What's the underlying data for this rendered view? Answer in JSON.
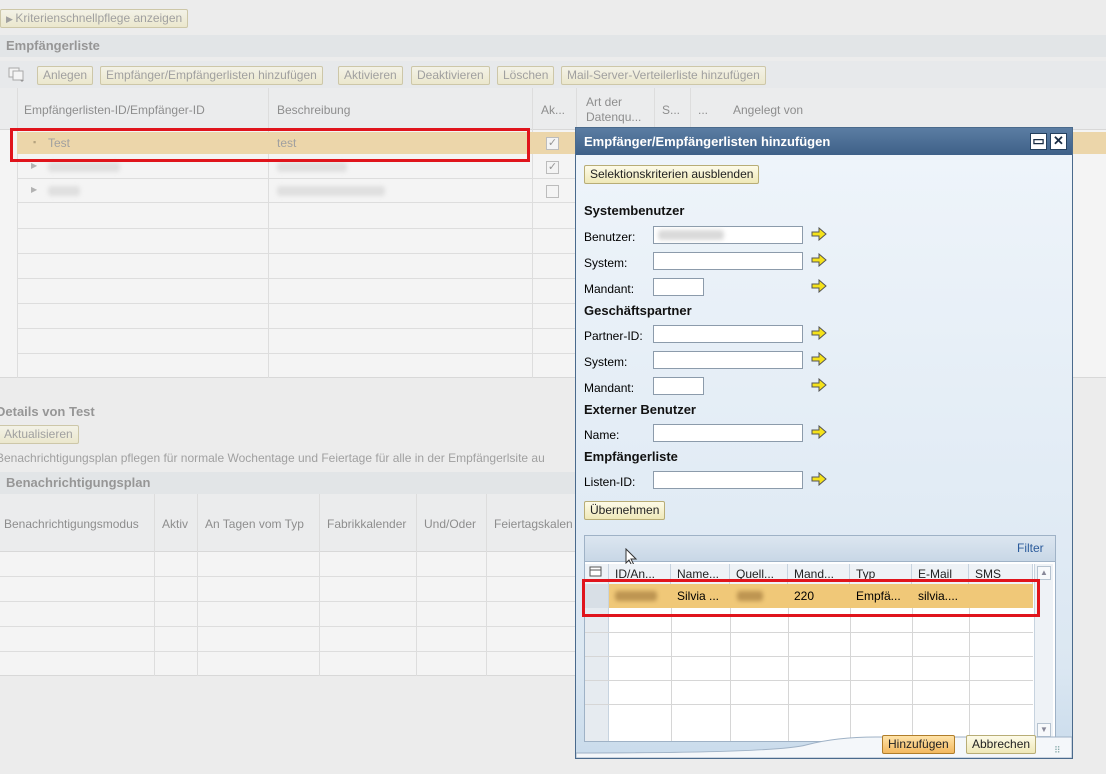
{
  "toolbar_top": {
    "criteria_toggle": "Kriterienschnellpflege anzeigen"
  },
  "recipient_list": {
    "title": "Empfängerliste",
    "buttons": {
      "anlegen": "Anlegen",
      "hinzufuegen": "Empfänger/Empfängerlisten hinzufügen",
      "aktivieren": "Aktivieren",
      "deaktivieren": "Deaktivieren",
      "loeschen": "Löschen",
      "mailserver": "Mail-Server-Verteilerliste hinzufügen"
    },
    "columns": {
      "id": "Empfängerlisten-ID/Empfänger-ID",
      "beschreibung": "Beschreibung",
      "ak": "Ak...",
      "art_l1": "Art der",
      "art_l2": "Datenqu...",
      "s": "S...",
      "dots": "...",
      "angelegt": "Angelegt von"
    },
    "rows": [
      {
        "id": "Test",
        "beschreibung": "test",
        "active": true
      }
    ]
  },
  "details": {
    "title": "Details von Test",
    "refresh": "Aktualisieren",
    "description": "Benachrichtigungsplan pflegen für normale Wochentage und Feiertage für alle in der Empfängerlsite au",
    "plan_title": "Benachrichtigungsplan",
    "columns": {
      "modus": "Benachrichtigungsmodus",
      "aktiv": "Aktiv",
      "tagen": "An Tagen vom Typ",
      "fabrik": "Fabrikkalender",
      "undoder": "Und/Oder",
      "feiertag": "Feiertagskalen"
    }
  },
  "dialog": {
    "title": "Empfänger/Empfängerlisten hinzufügen",
    "hide_criteria": "Selektionskriterien ausblenden",
    "groups": {
      "system_user": "Systembenutzer",
      "business_partner": "Geschäftspartner",
      "external_user": "Externer Benutzer",
      "recipient_list": "Empfängerliste"
    },
    "labels": {
      "benutzer": "Benutzer:",
      "system1": "System:",
      "mandant1": "Mandant:",
      "partner": "Partner-ID:",
      "system2": "System:",
      "mandant2": "Mandant:",
      "name": "Name:",
      "listen": "Listen-ID:"
    },
    "apply": "Übernehmen",
    "filter": "Filter",
    "result_columns": {
      "id": "ID/An...",
      "name": "Name...",
      "quelle": "Quell...",
      "mand": "Mand...",
      "typ": "Typ",
      "email": "E-Mail",
      "sms": "SMS"
    },
    "result_row": {
      "name": "Silvia ...",
      "mand": "220",
      "typ": "Empfä...",
      "email": "silvia...."
    },
    "add": "Hinzufügen",
    "cancel": "Abbrechen"
  },
  "colors": {
    "selected_row": "#f0c878",
    "highlight_red": "#e0141c",
    "dialog_title": "#3e6088"
  }
}
